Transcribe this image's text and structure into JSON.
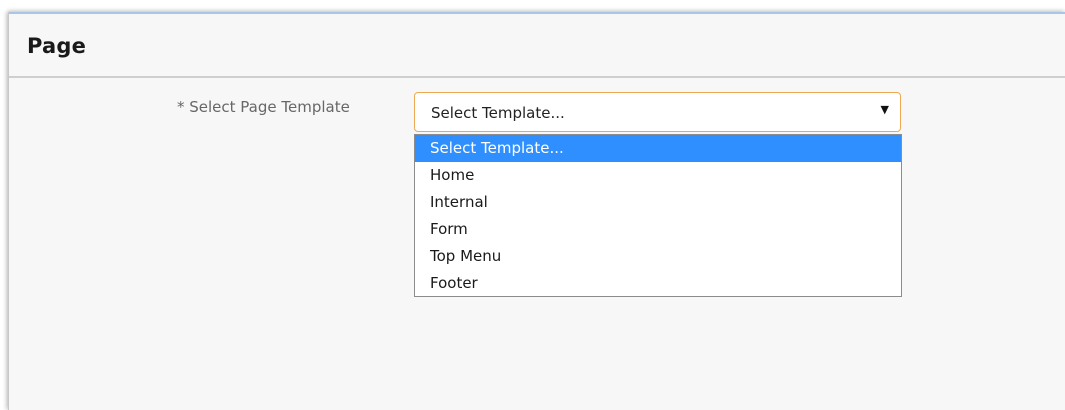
{
  "panel": {
    "title": "Page"
  },
  "form": {
    "template_field": {
      "label": "* Select Page Template",
      "selected_value": "Select Template...",
      "caret_glyph": "▼"
    }
  },
  "dropdown": {
    "options": [
      {
        "label": "Select Template...",
        "highlighted": true
      },
      {
        "label": "Home",
        "highlighted": false
      },
      {
        "label": "Internal",
        "highlighted": false
      },
      {
        "label": "Form",
        "highlighted": false
      },
      {
        "label": "Top Menu",
        "highlighted": false
      },
      {
        "label": "Footer",
        "highlighted": false
      }
    ]
  },
  "colors": {
    "highlight": "#2f8fff",
    "select_border": "#eda952",
    "label_text": "#676767"
  }
}
